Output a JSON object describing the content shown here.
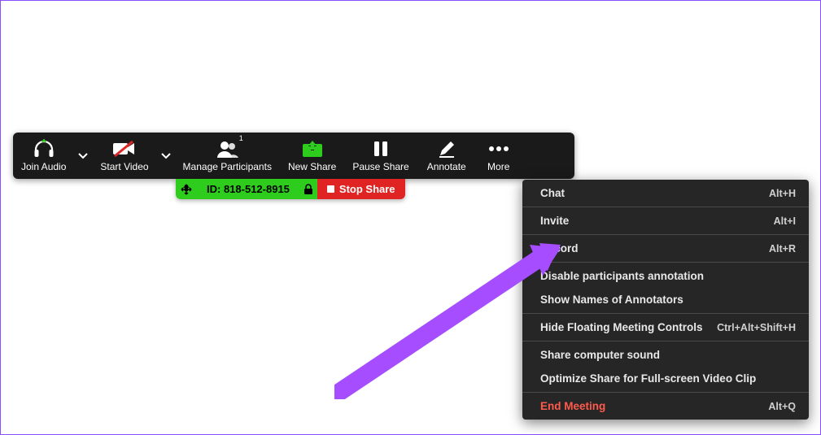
{
  "toolbar": {
    "join_audio": "Join Audio",
    "start_video": "Start Video",
    "manage_participants": "Manage Participants",
    "participants_count": "1",
    "new_share": "New Share",
    "pause_share": "Pause Share",
    "annotate": "Annotate",
    "more": "More"
  },
  "idbar": {
    "id_label": "ID: 818-512-8915",
    "stop_label": "Stop Share"
  },
  "menu": {
    "chat": {
      "label": "Chat",
      "shortcut": "Alt+H"
    },
    "invite": {
      "label": "Invite",
      "shortcut": "Alt+I"
    },
    "record": {
      "label": "Record",
      "shortcut": "Alt+R"
    },
    "disable_annot": {
      "label": "Disable participants annotation"
    },
    "show_names": {
      "label": "Show Names of Annotators"
    },
    "hide_controls": {
      "label": "Hide Floating Meeting Controls",
      "shortcut": "Ctrl+Alt+Shift+H"
    },
    "share_sound": {
      "label": "Share computer sound"
    },
    "optimize": {
      "label": "Optimize Share for Full-screen Video Clip"
    },
    "end": {
      "label": "End Meeting",
      "shortcut": "Alt+Q"
    }
  },
  "colors": {
    "toolbar_bg": "#1a1a1a",
    "green": "#2ecc1d",
    "red": "#e02424",
    "menu_bg": "#262626",
    "arrow": "#a64dff"
  }
}
